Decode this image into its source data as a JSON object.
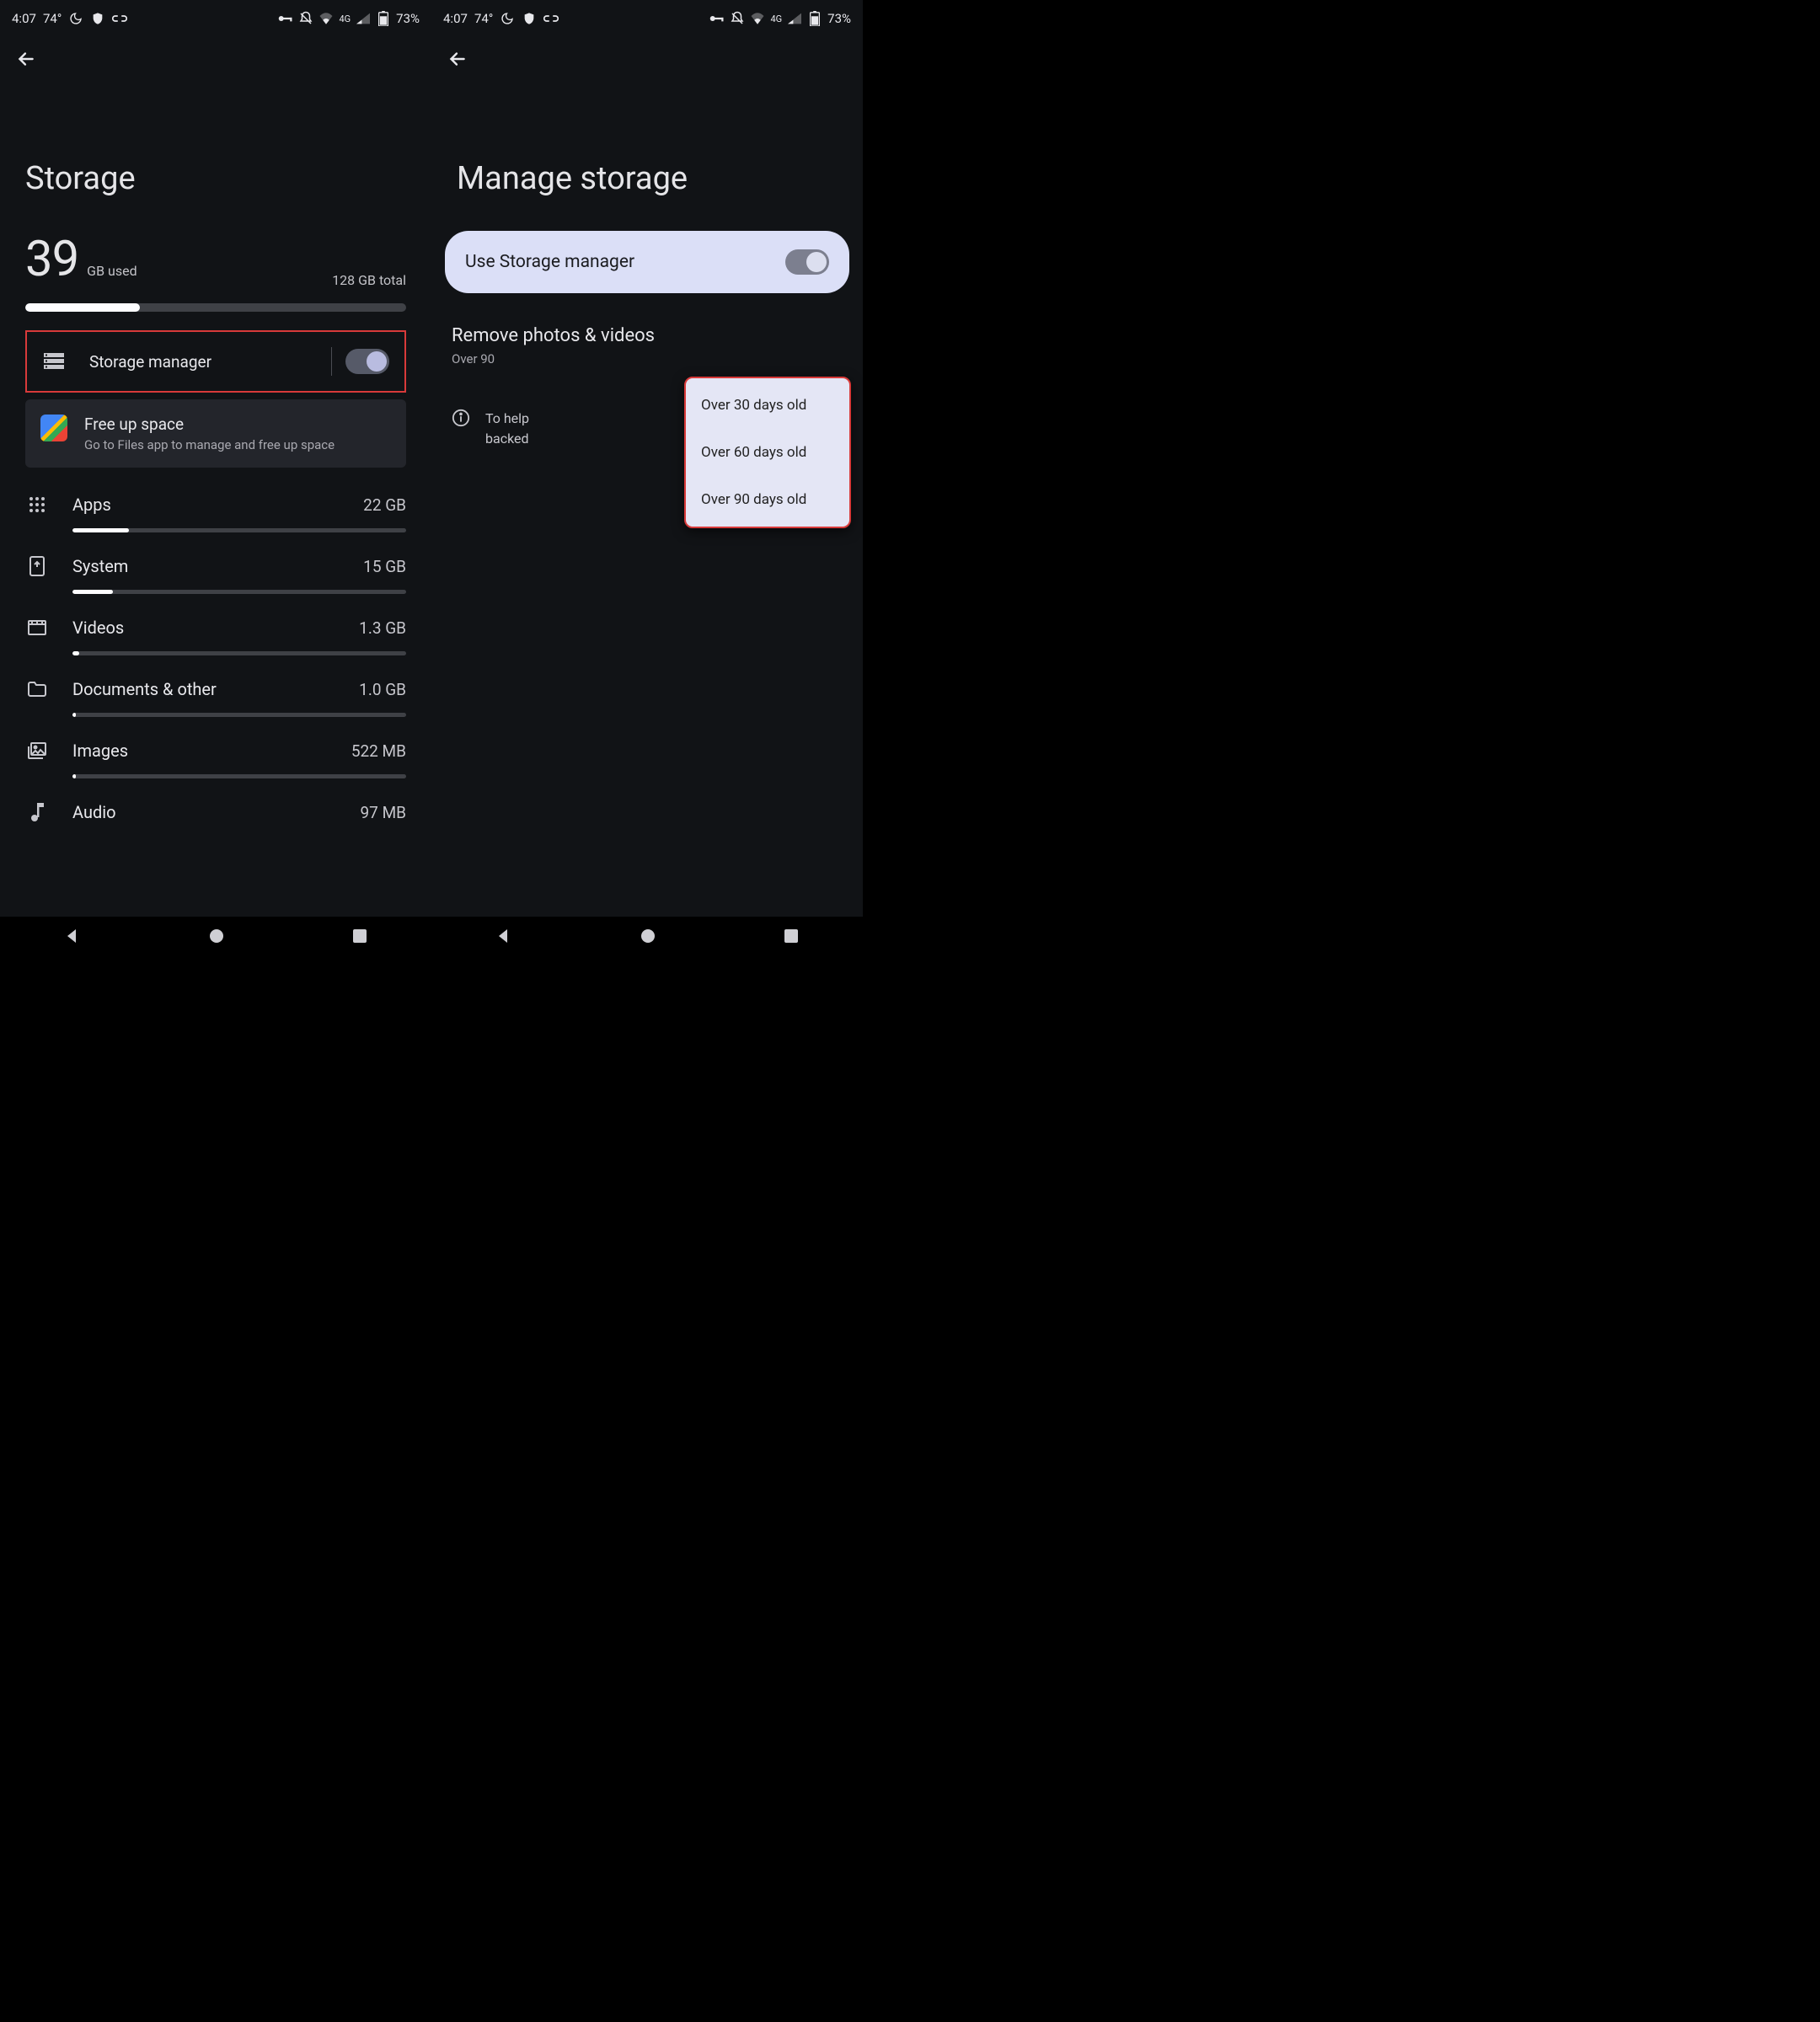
{
  "status": {
    "time": "4:07",
    "temp": "74°",
    "network_label": "4G",
    "battery": "73%"
  },
  "left": {
    "title": "Storage",
    "used_value": "39",
    "used_label": "GB used",
    "total_label": "128 GB total",
    "usage_pct": 30,
    "storage_manager_label": "Storage manager",
    "free_up": {
      "title": "Free up space",
      "subtitle": "Go to Files app to manage and free up space"
    },
    "categories": [
      {
        "name": "Apps",
        "value": "22 GB",
        "pct": 17
      },
      {
        "name": "System",
        "value": "15 GB",
        "pct": 12
      },
      {
        "name": "Videos",
        "value": "1.3 GB",
        "pct": 2
      },
      {
        "name": "Documents & other",
        "value": "1.0 GB",
        "pct": 1
      },
      {
        "name": "Images",
        "value": "522 MB",
        "pct": 1
      },
      {
        "name": "Audio",
        "value": "97 MB",
        "pct": 1
      }
    ]
  },
  "right": {
    "title": "Manage storage",
    "use_storage_manager_label": "Use Storage manager",
    "section_header": "Remove photos & videos",
    "section_sub_visible": "Over 90",
    "info_text": "To help                                                 rage manager removes backed                                               n your device.",
    "menu": {
      "items": [
        "Over 30 days old",
        "Over 60 days old",
        "Over 90 days old"
      ]
    }
  }
}
